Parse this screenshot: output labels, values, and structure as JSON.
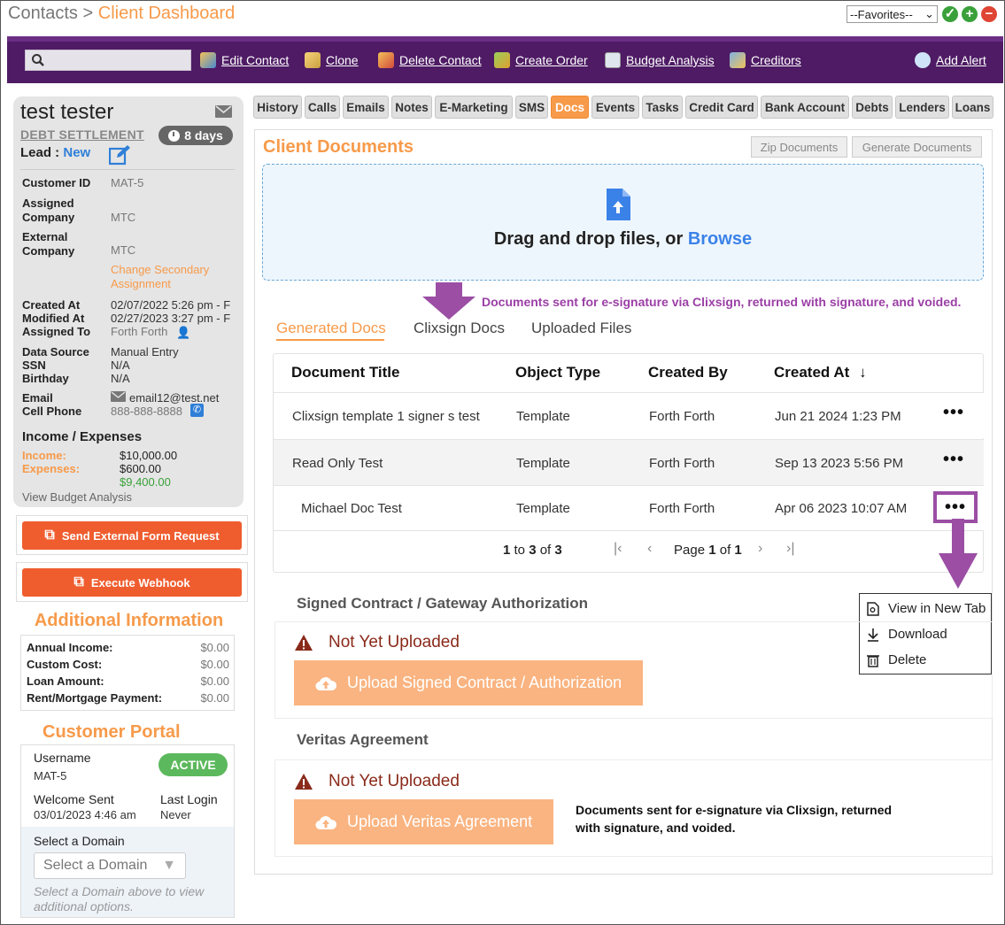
{
  "breadcrumb": {
    "parent": "Contacts",
    "separator": ">",
    "current": "Client Dashboard"
  },
  "favorites": {
    "selected": "--Favorites--"
  },
  "toolbar": {
    "search_placeholder": "",
    "items": [
      {
        "label": "Edit Contact",
        "icon": "edit-contact-icon"
      },
      {
        "label": "Clone",
        "icon": "clone-icon"
      },
      {
        "label": "Delete Contact",
        "icon": "delete-contact-icon"
      },
      {
        "label": "Create Order",
        "icon": "create-order-icon"
      },
      {
        "label": "Budget Analysis",
        "icon": "calculator-icon"
      },
      {
        "label": "Creditors",
        "icon": "creditors-icon"
      }
    ],
    "add_alert": "Add Alert"
  },
  "profile": {
    "name": "test tester",
    "program": "DEBT SETTLEMENT",
    "days_badge": "8 days",
    "lead_label": "Lead :",
    "lead_value": "New",
    "fields": {
      "customer_id_label": "Customer ID",
      "customer_id": "MAT-5",
      "assigned_company_label1": "Assigned",
      "assigned_company_label2": "Company",
      "assigned_company": "MTC",
      "external_company_label1": "External",
      "external_company_label2": "Company",
      "external_company": "MTC",
      "change_secondary": "Change Secondary Assignment",
      "created_at_label": "Created At",
      "created_at": "02/07/2022 5:26 pm - F",
      "modified_at_label": "Modified At",
      "modified_at": "02/27/2023 3:27 pm - F",
      "assigned_to_label": "Assigned To",
      "assigned_to": "Forth Forth",
      "data_source_label": "Data Source",
      "data_source": "Manual Entry",
      "ssn_label": "SSN",
      "ssn": "N/A",
      "birthday_label": "Birthday",
      "birthday": "N/A",
      "email_label": "Email",
      "email": "email12@test.net",
      "cell_label": "Cell Phone",
      "cell": "888-888-8888"
    },
    "income_title": "Income / Expenses",
    "income_label": "Income:",
    "income": "$10,000.00",
    "expenses_label": "Expenses:",
    "expenses": "$600.00",
    "net": "$9,400.00",
    "view_budget": "View Budget Analysis"
  },
  "actions": {
    "send_form": "Send External Form Request",
    "webhook": "Execute Webhook"
  },
  "additional": {
    "title": "Additional Information",
    "rows": [
      {
        "label": "Annual Income:",
        "value": "$0.00"
      },
      {
        "label": "Custom Cost:",
        "value": "$0.00"
      },
      {
        "label": "Loan Amount:",
        "value": "$0.00"
      },
      {
        "label": "Rent/Mortgage Payment:",
        "value": "$0.00"
      }
    ]
  },
  "portal": {
    "title": "Customer Portal",
    "username_label": "Username",
    "username": "MAT-5",
    "status": "ACTIVE",
    "welcome_label": "Welcome Sent",
    "welcome": "03/01/2023 4:46 am",
    "last_login_label": "Last Login",
    "last_login": "Never",
    "domain_label": "Select a Domain",
    "domain_select": "Select a Domain",
    "domain_hint": "Select a Domain above to view additional options."
  },
  "tabs": [
    "History",
    "Calls",
    "Emails",
    "Notes",
    "E-Marketing",
    "SMS",
    "Docs",
    "Events",
    "Tasks",
    "Credit Card",
    "Bank Account",
    "Debts",
    "Lenders",
    "Loans"
  ],
  "documents": {
    "title": "Client Documents",
    "zip_button": "Zip Documents",
    "generate_button": "Generate Documents",
    "drop_text": "Drag and drop files, or",
    "browse": "Browse",
    "annotation_top": "Documents sent for e-signature via Clixsign, returned with signature, and voided.",
    "subtabs": [
      "Generated Docs",
      "Clixsign Docs",
      "Uploaded Files"
    ],
    "columns": [
      "Document Title",
      "Object Type",
      "Created By",
      "Created At"
    ],
    "rows": [
      {
        "title": "Clixsign template 1 signer s test",
        "type": "Template",
        "by": "Forth Forth",
        "at": "Jun 21 2024 1:23 PM"
      },
      {
        "title": "Read Only Test",
        "type": "Template",
        "by": "Forth Forth",
        "at": "Sep 13 2023 5:56 PM"
      },
      {
        "title": "Michael Doc Test",
        "type": "Template",
        "by": "Forth Forth",
        "at": "Apr 06 2023 10:07 AM"
      }
    ],
    "pager": {
      "from": "1",
      "to_word": "to",
      "to": "3",
      "of_word": "of",
      "total": "3",
      "page_word": "Page",
      "page": "1",
      "page_of": "of",
      "pages": "1"
    },
    "context_menu": [
      "View in New Tab",
      "Download",
      "Delete"
    ],
    "signed_title": "Signed Contract / Gateway Authorization",
    "not_uploaded": "Not Yet Uploaded",
    "upload_signed": "Upload Signed Contract / Authorization",
    "veritas_title": "Veritas Agreement",
    "upload_veritas": "Upload Veritas Agreement",
    "annotation_bottom_1": "Documents sent for e-signature via Clixsign, returned",
    "annotation_bottom_2": "with signature, and voided."
  }
}
